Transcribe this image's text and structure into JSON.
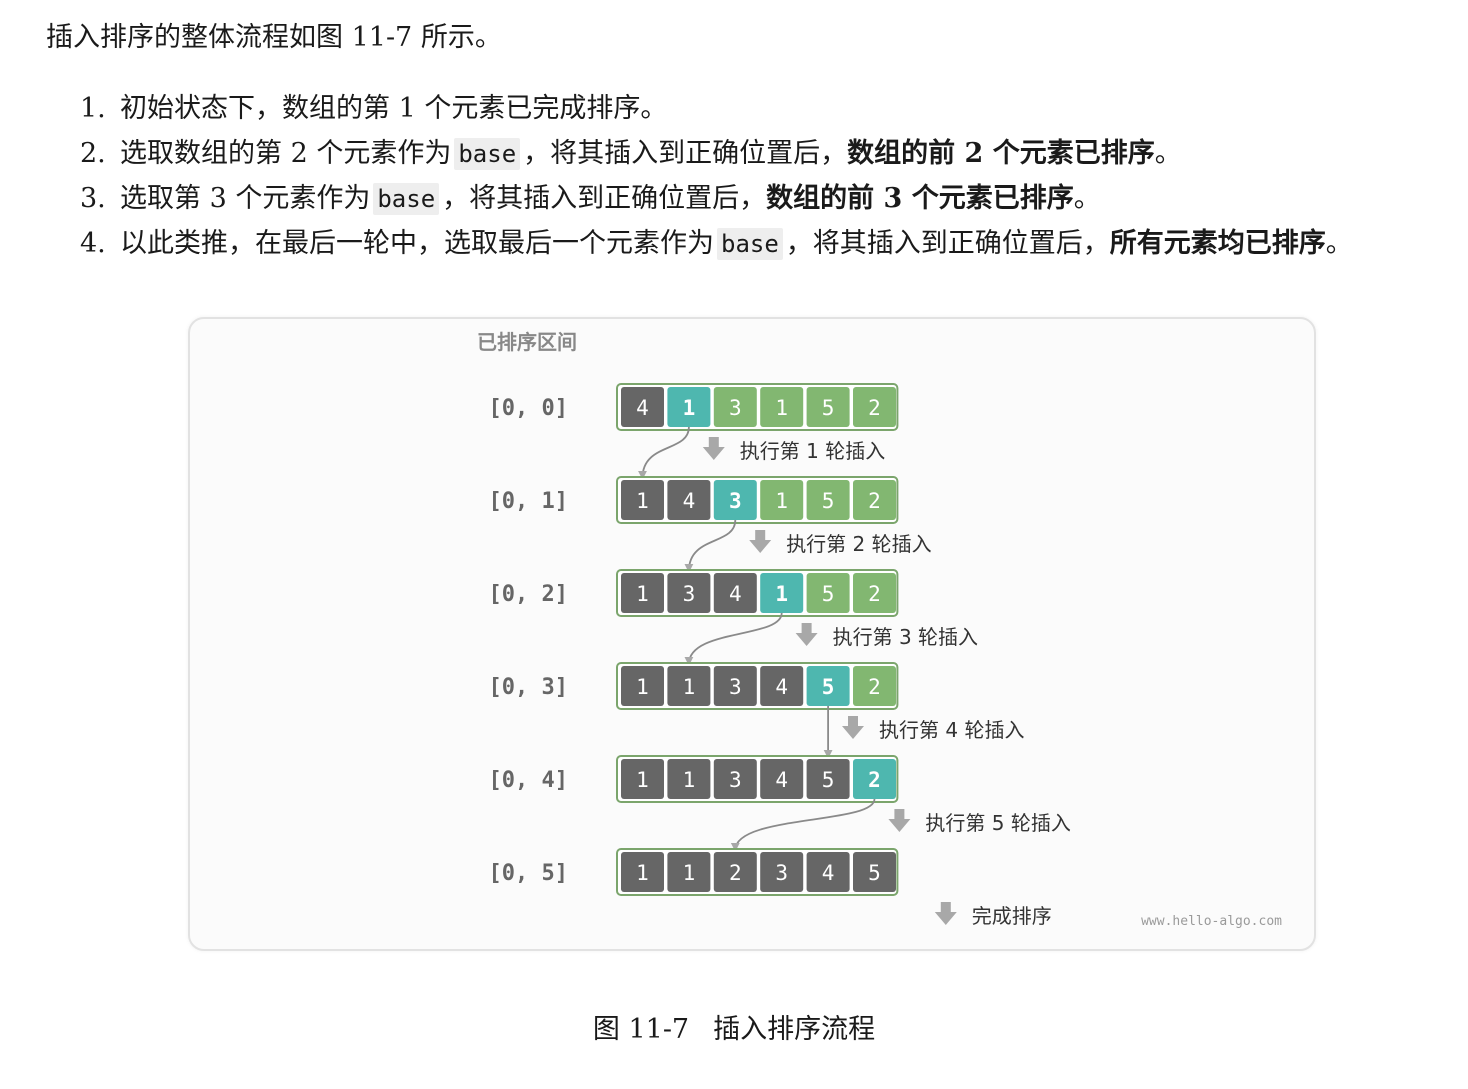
{
  "intro": "插入排序的整体流程如图 11-7 所示。",
  "steps": [
    {
      "num": "1.",
      "pre": "初始状态下，数组的第 1 个元素已完成排序。",
      "code": "",
      "mid": "",
      "bold": "",
      "post": ""
    },
    {
      "num": "2.",
      "pre": "选取数组的第 2 个元素作为",
      "code": "base",
      "mid": "，将其插入到正确位置后，",
      "bold": "数组的前 2 个元素已排序",
      "post": "。"
    },
    {
      "num": "3.",
      "pre": "选取第 3 个元素作为",
      "code": "base",
      "mid": "，将其插入到正确位置后，",
      "bold": "数组的前 3 个元素已排序",
      "post": "。"
    },
    {
      "num": "4.",
      "pre": "以此类推，在最后一轮中，选取最后一个元素作为",
      "code": "base",
      "mid": "，将其插入到正确位置后，",
      "bold": "所有元素均已排序",
      "post": "。"
    }
  ],
  "figure": {
    "header": "已排序区间",
    "watermark": "www.hello-algo.com",
    "colors": {
      "sorted": "#666666",
      "unsorted": "#82b771",
      "base": "#4eb7af",
      "border": "#7ba56c",
      "arrow": "#a8a8a8",
      "label": "#666666"
    },
    "rows": [
      {
        "range": "[0, 0]",
        "values": [
          4,
          1,
          3,
          1,
          5,
          2
        ],
        "base": 1,
        "step": "执行第  1  轮插入"
      },
      {
        "range": "[0, 1]",
        "values": [
          1,
          4,
          3,
          1,
          5,
          2
        ],
        "base": 2,
        "step": "执行第  2  轮插入"
      },
      {
        "range": "[0, 2]",
        "values": [
          1,
          3,
          4,
          1,
          5,
          2
        ],
        "base": 3,
        "step": "执行第  3  轮插入"
      },
      {
        "range": "[0, 3]",
        "values": [
          1,
          1,
          3,
          4,
          5,
          2
        ],
        "base": 4,
        "step": "执行第  4  轮插入"
      },
      {
        "range": "[0, 4]",
        "values": [
          1,
          1,
          3,
          4,
          5,
          2
        ],
        "base": 5,
        "step": "执行第  5  轮插入"
      },
      {
        "range": "[0, 5]",
        "values": [
          1,
          1,
          2,
          3,
          4,
          5
        ],
        "base": -1,
        "step": "完成排序"
      }
    ],
    "insert_targets": [
      0,
      1,
      1,
      4,
      2
    ]
  },
  "caption": {
    "num": "图 11-7",
    "title": "插入排序流程"
  }
}
